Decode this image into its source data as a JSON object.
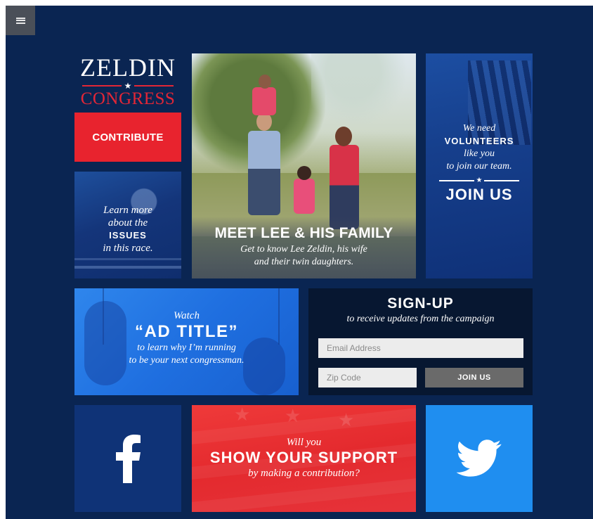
{
  "menu": {
    "icon": "hamburger-menu-icon"
  },
  "logo": {
    "line1": "ZELDIN",
    "star": "★",
    "line2": "CONGRESS"
  },
  "contribute": {
    "label": "CONTRIBUTE"
  },
  "issues": {
    "line1": "Learn more",
    "line2": "about the",
    "line3": "ISSUES",
    "line4": "in this race."
  },
  "family": {
    "title": "MEET LEE & HIS FAMILY",
    "subtitle_line1": "Get to know Lee Zeldin, his wife",
    "subtitle_line2": "and their twin daughters."
  },
  "volunteers": {
    "line1": "We need",
    "line2": "VOLUNTEERS",
    "line3": "like you",
    "line4": "to join our team.",
    "star": "★",
    "cta": "JOIN US"
  },
  "watch": {
    "line1": "Watch",
    "line2": "“AD TITLE”",
    "line3": "to learn why I’m running",
    "line4": "to be your next congressman."
  },
  "signup": {
    "title": "SIGN-UP",
    "subtitle": "to receive updates from the campaign",
    "email_placeholder": "Email Address",
    "zip_placeholder": "Zip Code",
    "button": "JOIN US"
  },
  "facebook": {
    "icon": "facebook-icon"
  },
  "support": {
    "line1": "Will you",
    "line2": "SHOW YOUR SUPPORT",
    "line3": "by making a contribution?"
  },
  "twitter": {
    "icon": "twitter-bird-icon"
  },
  "colors": {
    "page_bg": "#0a2552",
    "brand_red": "#e8232e",
    "brand_blue": "#1f8ef0",
    "signup_bg": "#071731"
  }
}
